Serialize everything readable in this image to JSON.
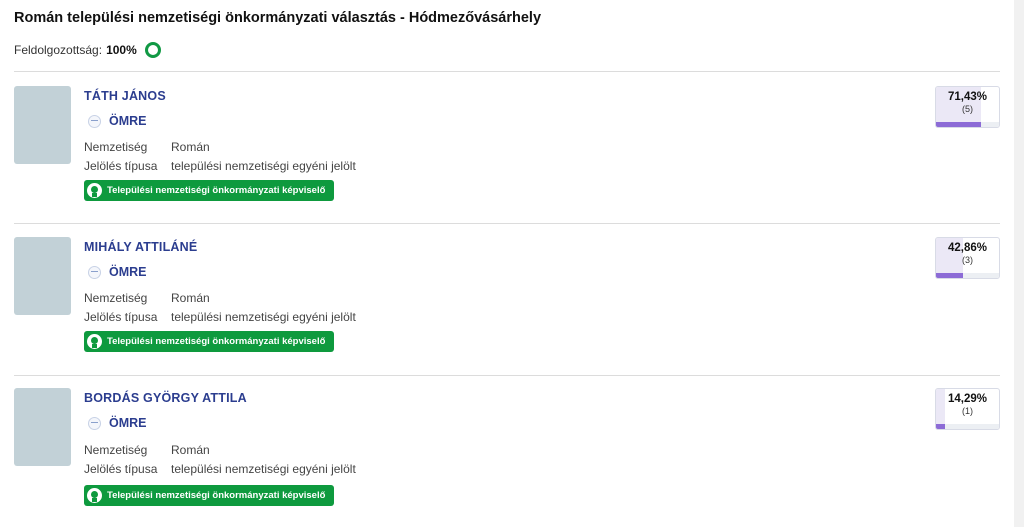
{
  "header": {
    "title": "Román települési nemzetiségi önkormányzati választás - Hódmezővásárhely",
    "progress_label": "Feldolgozottság:",
    "progress_value": "100%"
  },
  "colors": {
    "accent_green": "#0e9a3e",
    "name_blue": "#2b3d8f",
    "vote_purple": "#8c6bd6"
  },
  "labels": {
    "nationality": "Nemzetiség",
    "nomination_type": "Jelölés típusa"
  },
  "candidates": [
    {
      "name": "TÁTH JÁNOS",
      "party": "ÖMRE",
      "nationality": "Román",
      "nomination": "települési nemzetiségi egyéni jelölt",
      "badge": "Települési nemzetiségi önkormányzati képviselő",
      "percent": "71,43%",
      "votes": "(5)",
      "share": 0.7143
    },
    {
      "name": "MIHÁLY ATTILÁNÉ",
      "party": "ÖMRE",
      "nationality": "Román",
      "nomination": "települési nemzetiségi egyéni jelölt",
      "badge": "Települési nemzetiségi önkormányzati képviselő",
      "percent": "42,86%",
      "votes": "(3)",
      "share": 0.4286
    },
    {
      "name": "BORDÁS GYÖRGY ATTILA",
      "party": "ÖMRE",
      "nationality": "Román",
      "nomination": "települési nemzetiségi egyéni jelölt",
      "badge": "Települési nemzetiségi önkormányzati képviselő",
      "percent": "14,29%",
      "votes": "(1)",
      "share": 0.1429
    }
  ]
}
